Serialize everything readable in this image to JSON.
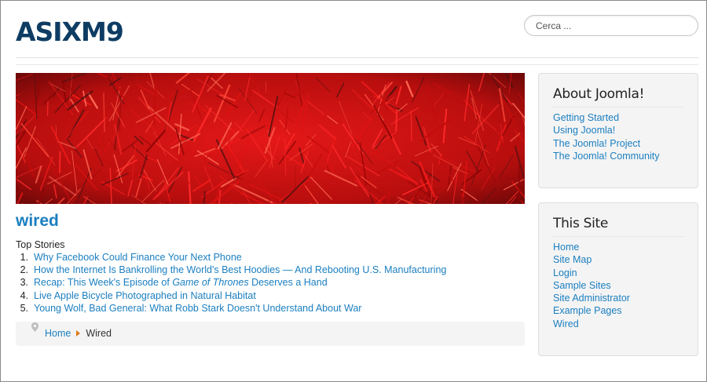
{
  "site": {
    "brand": "ASIXM9"
  },
  "search": {
    "placeholder": "Cerca ..."
  },
  "article": {
    "title": "wired",
    "section_label": "Top Stories",
    "stories": [
      {
        "num": "1.",
        "pre": "Why Facebook Could Finance Your Next Phone",
        "em": "",
        "post": ""
      },
      {
        "num": "2.",
        "pre": "How the Internet Is Bankrolling the World's Best Hoodies — And Rebooting U.S. Manufacturing",
        "em": "",
        "post": ""
      },
      {
        "num": "3.",
        "pre": "Recap: This Week's Episode of ",
        "em": "Game of Thrones",
        "post": " Deserves a Hand"
      },
      {
        "num": "4.",
        "pre": "Live Apple Bicycle Photographed in Natural Habitat",
        "em": "",
        "post": ""
      },
      {
        "num": "5.",
        "pre": "Young Wolf, Bad General: What Robb Stark Doesn't Understand About War",
        "em": "",
        "post": ""
      }
    ]
  },
  "breadcrumb": {
    "home": "Home",
    "current": "Wired"
  },
  "sidebar": {
    "about": {
      "title": "About Joomla!",
      "links": [
        "Getting Started",
        "Using Joomla!",
        "The Joomla! Project",
        "The Joomla! Community"
      ]
    },
    "this_site": {
      "title": "This Site",
      "links": [
        "Home",
        "Site Map",
        "Login",
        "Sample Sites",
        "Site Administrator",
        "Example Pages",
        "Wired"
      ]
    }
  },
  "colors": {
    "brand": "#0e3c63",
    "link": "#1b7fc0",
    "breadcrumb_separator": "#e07a1a",
    "banner": "#d81414"
  }
}
